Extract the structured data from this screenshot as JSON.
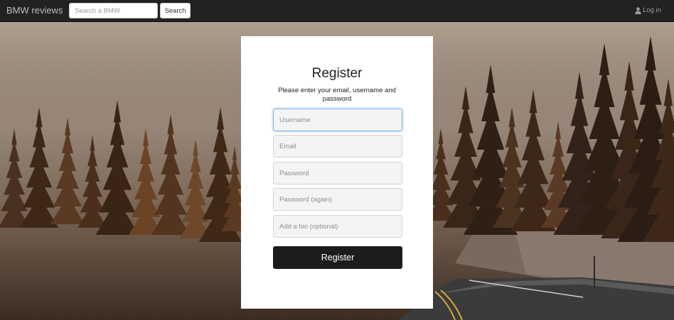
{
  "navbar": {
    "brand": "BMW reviews",
    "search_placeholder": "Search a BMW",
    "search_button": "Search",
    "login_label": "Log in",
    "login_icon": "user-icon"
  },
  "register": {
    "title": "Register",
    "subtitle": "Please enter your email, username and password",
    "fields": {
      "username_placeholder": "Username",
      "email_placeholder": "Email",
      "password_placeholder": "Password",
      "password_again_placeholder": "Password (again)",
      "bio_placeholder": "Add a bio (optional)"
    },
    "submit_label": "Register"
  },
  "background": {
    "description_icon": "forest-road-background"
  },
  "colors": {
    "navbar": "#222222",
    "card": "#ffffff",
    "button": "#1c1c1c",
    "focus": "#7fb2e6"
  }
}
